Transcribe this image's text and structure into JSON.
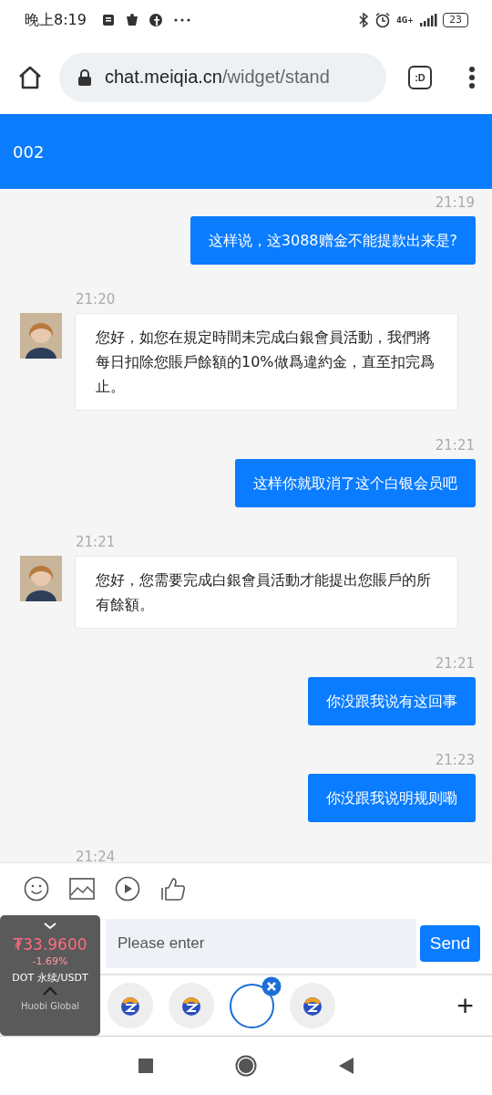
{
  "status_bar": {
    "time": "晚上8:19",
    "network": "4G+",
    "battery": "23"
  },
  "browser": {
    "url_host": "chat.meiqia.cn",
    "url_path": "/widget/stand",
    "tab_button": ":D"
  },
  "header": {
    "title": "002"
  },
  "messages": [
    {
      "kind": "sent",
      "time": "21:19",
      "text": "这样说，这3088赠金不能提款出来是?"
    },
    {
      "kind": "received",
      "time": "21:20",
      "text": "您好，如您在規定時間未完成白銀會員活動，我們將每日扣除您賬戶餘額的10%做爲違約金，直至扣完爲止。"
    },
    {
      "kind": "sent",
      "time": "21:21",
      "text": "这样你就取消了这个白银会员吧"
    },
    {
      "kind": "received",
      "time": "21:21",
      "text": "您好，您需要完成白銀會員活動才能提出您賬戶的所有餘額。"
    },
    {
      "kind": "sent",
      "time": "21:21",
      "text": "你没跟我说有这回事"
    },
    {
      "kind": "sent",
      "time": "21:23",
      "text": "你没跟我说明规则嘞"
    },
    {
      "kind": "received",
      "time": "21:24"
    }
  ],
  "composer": {
    "placeholder": "Please enter",
    "send": "Send"
  },
  "dock": {
    "bubbles": [
      {
        "selected": false
      },
      {
        "selected": false
      },
      {
        "selected": true
      },
      {
        "selected": false
      }
    ],
    "add": "+"
  },
  "ticker": {
    "price": "₮33.9600",
    "change": "-1.69%",
    "pair": "DOT 永续/USDT",
    "brand": "Huobi Global"
  }
}
